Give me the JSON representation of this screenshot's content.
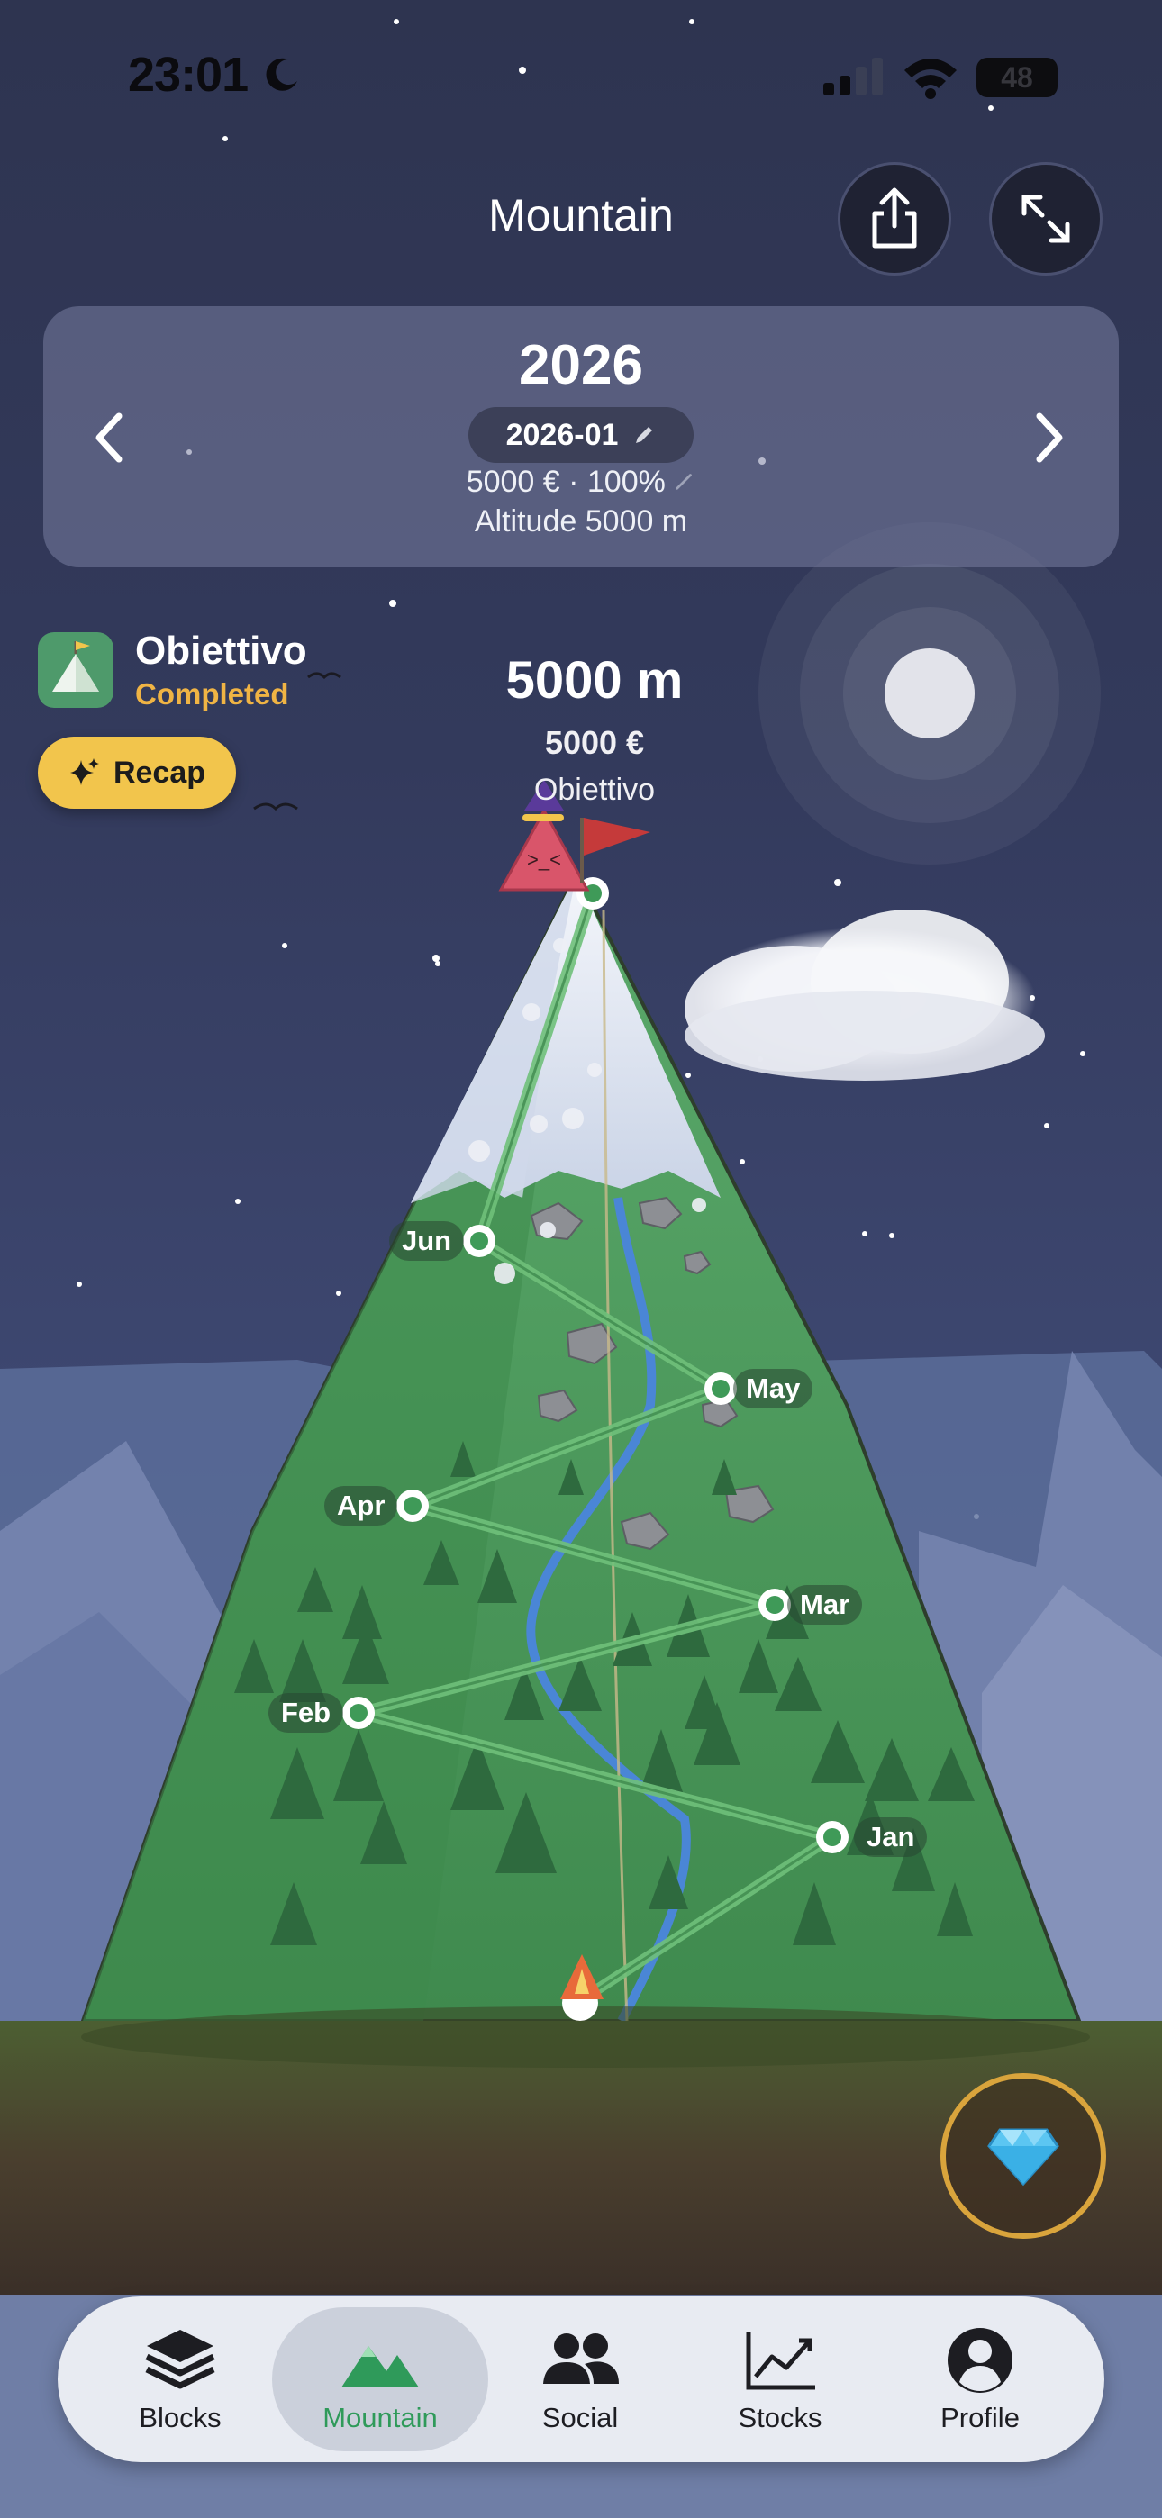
{
  "status_bar": {
    "time": "23:01",
    "battery": "48"
  },
  "header": {
    "title": "Mountain"
  },
  "icons": {
    "share": "share-icon",
    "expand": "expand-icon",
    "prev": "chevron-left-icon",
    "next": "chevron-right-icon",
    "edit": "pencil-icon",
    "sparkle": "sparkle-icon",
    "gem": "diamond-icon"
  },
  "year_card": {
    "year": "2026",
    "month": "2026-01",
    "money_line": "5000 € · 100%",
    "altitude_line": "Altitude 5000 m"
  },
  "goal": {
    "title": "Obiettivo",
    "status": "Completed",
    "recap_label": "Recap"
  },
  "summit": {
    "altitude": "5000 m",
    "money": "5000 €",
    "label": "Obiettivo"
  },
  "milestones": [
    "Jan",
    "Feb",
    "Mar",
    "Apr",
    "May",
    "Jun"
  ],
  "tabs": [
    {
      "label": "Blocks",
      "icon": "layers-icon",
      "active": false
    },
    {
      "label": "Mountain",
      "icon": "mountain-icon",
      "active": true
    },
    {
      "label": "Social",
      "icon": "people-icon",
      "active": false
    },
    {
      "label": "Stocks",
      "icon": "chart-icon",
      "active": false
    },
    {
      "label": "Profile",
      "icon": "profile-icon",
      "active": false
    }
  ],
  "colors": {
    "accent_green": "#2f9a5a",
    "completed": "#f0b444",
    "recap": "#f2c54c",
    "gem_ring": "#d9a43c"
  }
}
